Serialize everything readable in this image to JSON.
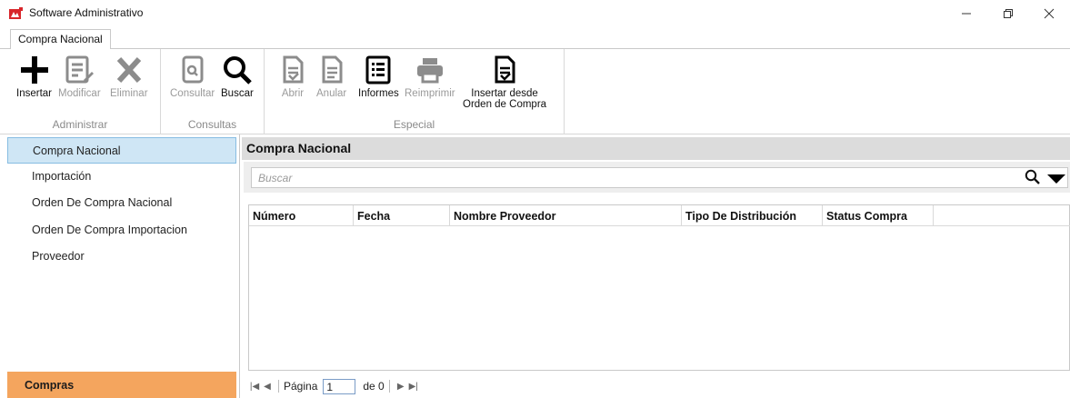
{
  "window": {
    "title": "Software Administrativo",
    "minimize_glyph": "—",
    "maximize_glyph": "❐",
    "close_glyph": "✕"
  },
  "ribbon": {
    "tab_label": "Compra Nacional",
    "groups": {
      "administrar": "Administrar",
      "consultas": "Consultas",
      "especial": "Especial"
    },
    "buttons": {
      "insertar": "Insertar",
      "modificar": "Modificar",
      "eliminar": "Eliminar",
      "consultar": "Consultar",
      "buscar": "Buscar",
      "abrir": "Abrir",
      "anular": "Anular",
      "informes": "Informes",
      "reimprimir": "Reimprimir",
      "insertar_desde_line1": "Insertar desde",
      "insertar_desde_line2": "Orden de Compra"
    }
  },
  "nav": {
    "items": [
      {
        "label": "Compra Nacional",
        "active": true
      },
      {
        "label": "Importación",
        "active": false
      },
      {
        "label": "Orden De Compra Nacional",
        "active": false
      },
      {
        "label": "Orden De Compra Importacion",
        "active": false
      },
      {
        "label": "Proveedor",
        "active": false
      }
    ],
    "footer": "Compras"
  },
  "main": {
    "panel_title": "Compra Nacional",
    "search_placeholder": "Buscar",
    "columns": [
      "Número",
      "Fecha",
      "Nombre Proveedor",
      "Tipo De Distribución",
      "Status Compra"
    ],
    "rows": []
  },
  "pager": {
    "label": "Página",
    "page": "1",
    "of_label": "de 0"
  },
  "colors": {
    "nav_active_bg": "#cfe6f5",
    "nav_footer_bg": "#f4a55e",
    "panel_head_bg": "#dcdcdc",
    "disabled_text": "#9a9a9a"
  }
}
